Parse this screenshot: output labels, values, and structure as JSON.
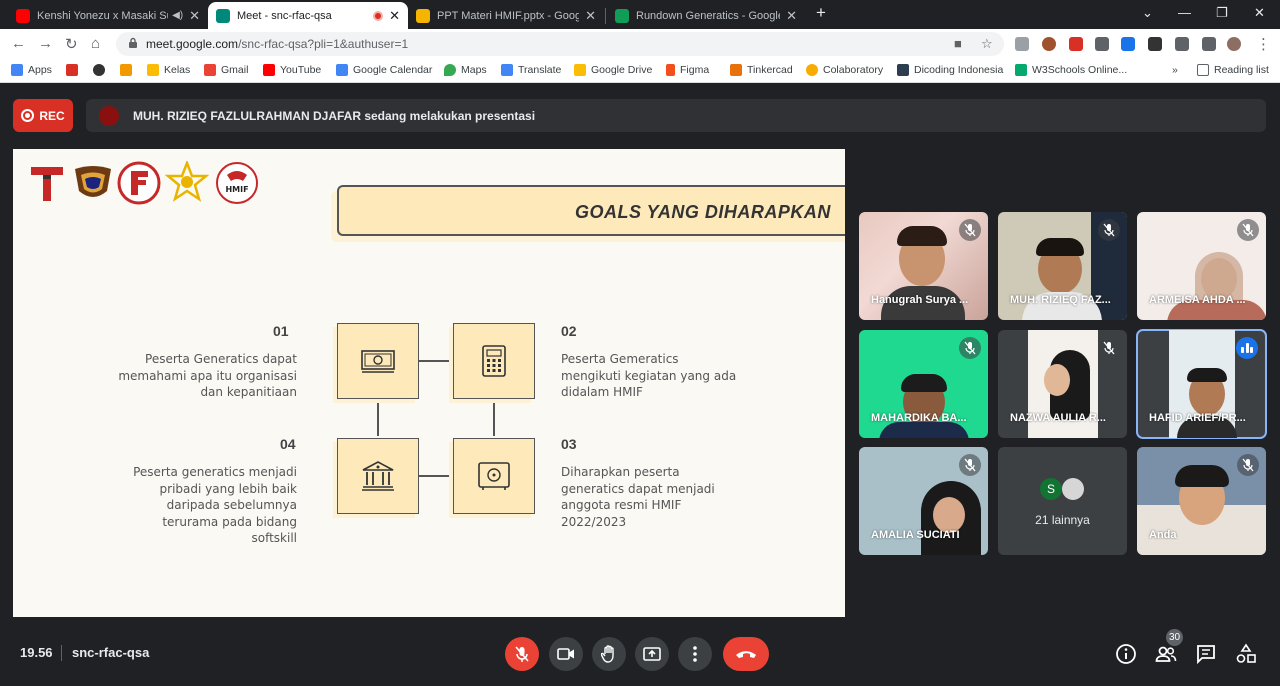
{
  "browser": {
    "tabs": [
      {
        "title": "Kenshi Yonezu x Masaki Sud",
        "favicon_color": "#ff0000",
        "audio": true
      },
      {
        "title": "Meet - snc-rfac-qsa",
        "favicon_color": "#00897b",
        "recording": true
      },
      {
        "title": "PPT Materi HMIF.pptx - Google S",
        "favicon_color": "#f4b400"
      },
      {
        "title": "Rundown Generatics - Google Sp",
        "favicon_color": "#0f9d58"
      }
    ],
    "url_host": "meet.google.com",
    "url_path": "/snc-rfac-qsa?pli=1&authuser=1",
    "bookmarks": [
      {
        "label": "Apps",
        "color": "#4285f4"
      },
      {
        "label": "",
        "color": "#d93025"
      },
      {
        "label": "",
        "color": "#333333"
      },
      {
        "label": "",
        "color": "#f29900"
      },
      {
        "label": "Kelas",
        "color": "#fbbc04"
      },
      {
        "label": "Gmail",
        "color": "#ea4335"
      },
      {
        "label": "YouTube",
        "color": "#ff0000"
      },
      {
        "label": "Google Calendar",
        "color": "#4285f4"
      },
      {
        "label": "Maps",
        "color": "#34a853"
      },
      {
        "label": "Translate",
        "color": "#4285f4"
      },
      {
        "label": "Google Drive",
        "color": "#fbbc04"
      },
      {
        "label": "Figma",
        "color": "#f24e1e"
      },
      {
        "label": "Tinkercad",
        "color": "#e8710a"
      },
      {
        "label": "Colaboratory",
        "color": "#f9ab00"
      },
      {
        "label": "Dicoding Indonesia",
        "color": "#2d3e50"
      },
      {
        "label": "W3Schools Online...",
        "color": "#04aa6d"
      }
    ],
    "more_bookmarks": "»",
    "reading_list": "Reading list"
  },
  "meet": {
    "rec_label": "REC",
    "presenter_banner": "MUH. RIZIEQ FAZLULRAHMAN DJAFAR sedang melakukan presentasi",
    "slide": {
      "title": "GOALS YANG DIHARAPKAN",
      "goals": [
        {
          "num": "01",
          "text": [
            "Peserta Generatics dapat",
            "memahami apa itu organisasi",
            "dan kepanitiaan"
          ],
          "icon": "money-icon"
        },
        {
          "num": "02",
          "text": [
            "Peserta Gemeratics",
            "mengikuti kegiatan yang ada",
            "didalam HMIF"
          ],
          "icon": "calculator-icon"
        },
        {
          "num": "03",
          "text": [
            "Diharapkan peserta",
            "generatics dapat menjadi",
            "anggota resmi HMIF",
            "2022/2023"
          ],
          "icon": "safe-icon"
        },
        {
          "num": "04",
          "text": [
            "Peserta generatics menjadi",
            "pribadi yang lebih baik",
            "daripada sebelumnya",
            "terurama pada bidang",
            "softskill"
          ],
          "icon": "bank-icon"
        }
      ]
    },
    "participants": [
      {
        "name": "Hanugrah Surya ...",
        "muted": true
      },
      {
        "name": "MUH. RIZIEQ FAZ...",
        "muted": true
      },
      {
        "name": "ARMEISA AHDA ...",
        "muted": true
      },
      {
        "name": "MAHARDIKA BA...",
        "muted": true
      },
      {
        "name": "NAZWA AULIA R...",
        "muted": true
      },
      {
        "name": "HAFID ARIEF/PR...",
        "muted": false,
        "speaking": true
      },
      {
        "name": "AMALIA SUCIATI",
        "muted": true
      },
      {
        "name": "Anda",
        "muted": true
      }
    ],
    "others": {
      "avatar_letter": "S",
      "label": "21 lainnya"
    },
    "time": "19.56",
    "meeting_code": "snc-rfac-qsa",
    "participant_count": "30"
  },
  "colors": {
    "end_call": "#ea4335",
    "speaking": "#1a73e8",
    "banner": "#fde9b9"
  }
}
